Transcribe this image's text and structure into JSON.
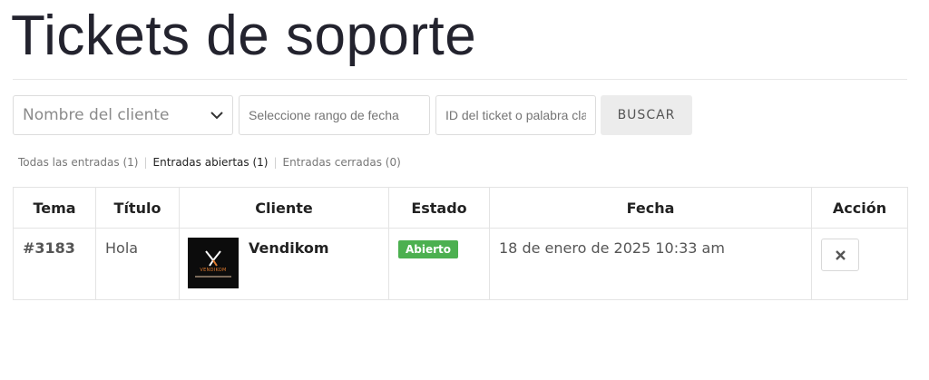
{
  "page": {
    "title": "Tickets de soporte"
  },
  "filters": {
    "client_select": {
      "value": "Nombre del cliente"
    },
    "date_range": {
      "placeholder": "Seleccione rango de fecha"
    },
    "ticket_search": {
      "placeholder": "ID del ticket o palabra clave"
    },
    "search_button": "BUSCAR"
  },
  "subnav": {
    "all": "Todas las entradas (1)",
    "open": "Entradas abiertas (1)",
    "closed": "Entradas cerradas (0)",
    "current": "open"
  },
  "table": {
    "headers": [
      "Tema",
      "Título",
      "Cliente",
      "Estado",
      "Fecha",
      "Acción"
    ],
    "rows": [
      {
        "id": "#3183",
        "title": "Hola",
        "client": {
          "name": "Vendikom",
          "logo_text": "VENDIKOM"
        },
        "status": "Abierto",
        "status_color": "#4cb050",
        "date": "18 de enero de 2025 10:33 am",
        "action_icon": "close-icon"
      }
    ]
  }
}
